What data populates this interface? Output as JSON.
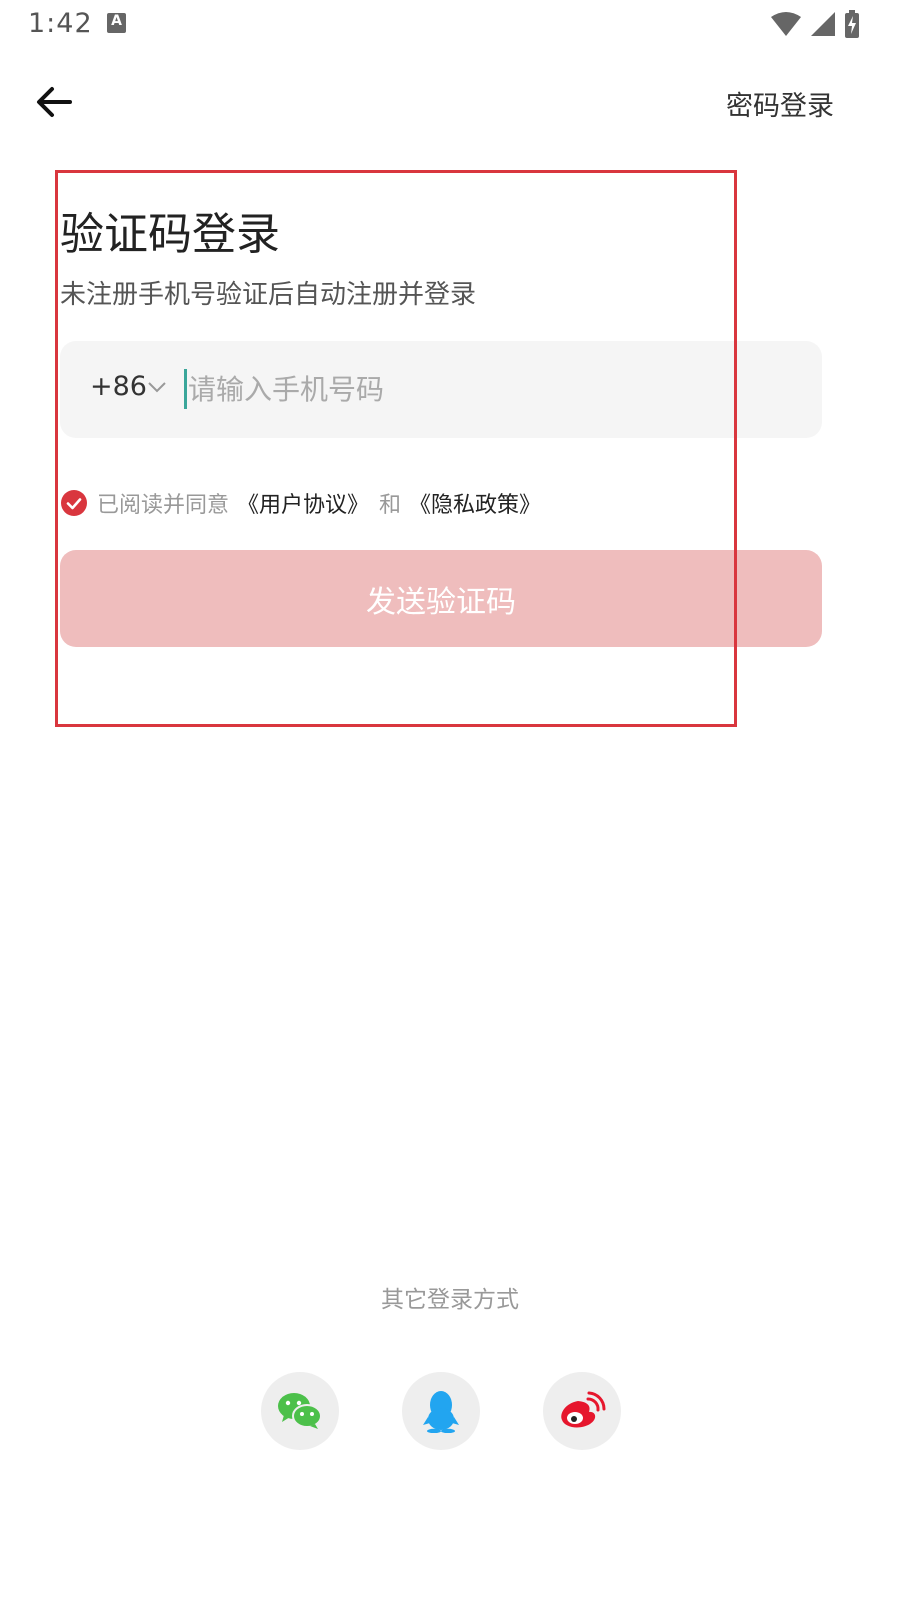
{
  "status_bar": {
    "time": "1:42",
    "notification_icon": "a-icon",
    "icons": [
      "wifi-icon",
      "signal-icon",
      "battery-charging-icon"
    ]
  },
  "header": {
    "back_icon": "arrow-left-icon",
    "password_login": "密码登录"
  },
  "login": {
    "title": "验证码登录",
    "subtitle": "未注册手机号验证后自动注册并登录",
    "country_code": "+86",
    "phone_placeholder": "请输入手机号码",
    "phone_value": "",
    "agree_checked": true,
    "agree_text": "已阅读并同意",
    "user_agreement": "《用户协议》",
    "and_text": "和",
    "privacy_policy": "《隐私政策》",
    "send_button": "发送验证码"
  },
  "other_login": {
    "label": "其它登录方式",
    "methods": [
      {
        "icon": "wechat-icon",
        "color": "#4cc04a"
      },
      {
        "icon": "qq-icon",
        "color": "#22a5f0"
      },
      {
        "icon": "weibo-icon",
        "color": "#e6162d"
      }
    ]
  },
  "colors": {
    "accent": "#d9363e",
    "send_button_disabled": "#efbdbd",
    "input_bg": "#f5f5f5",
    "cursor": "#3aa69a"
  }
}
